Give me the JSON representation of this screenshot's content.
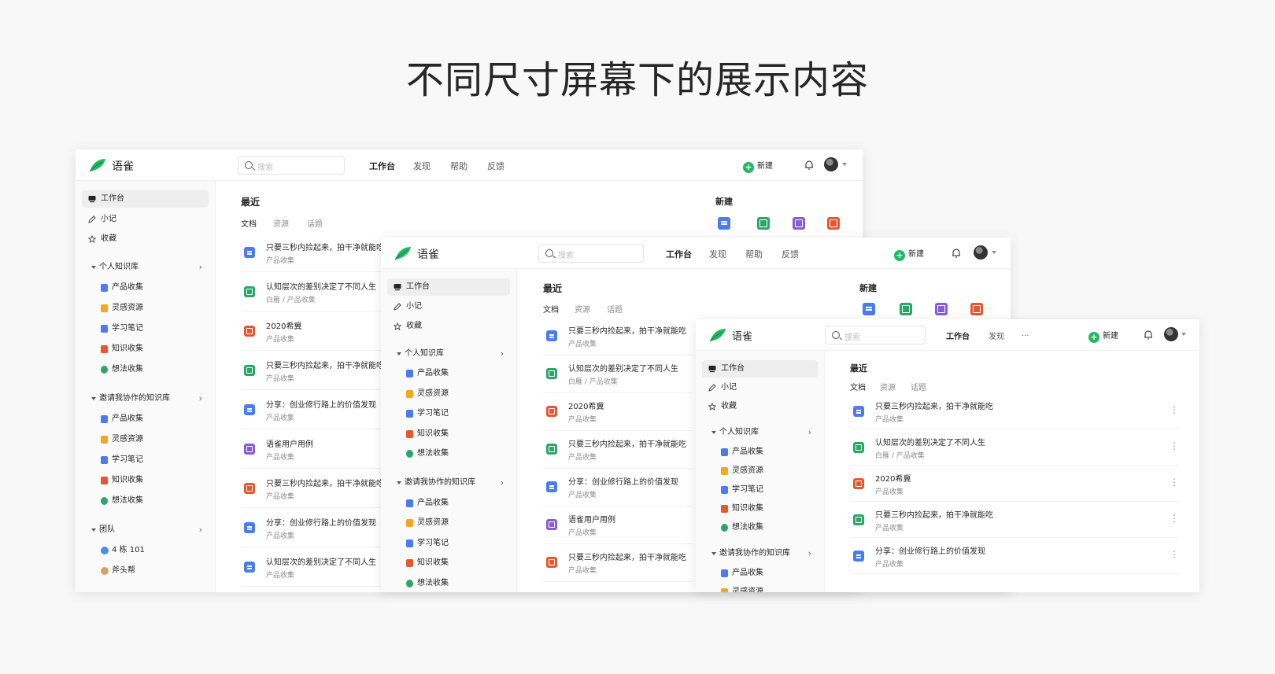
{
  "title": "不同尺寸屏幕下的展示内容",
  "brand": "语雀",
  "search_placeholder": "搜索",
  "nav": {
    "workbench": "工作台",
    "discover": "发现",
    "help": "帮助",
    "feedback": "反馈",
    "more": "..."
  },
  "new_label": "新建",
  "sidebar": {
    "workbench": "工作台",
    "notes": "小记",
    "favorites": "收藏",
    "personal_group": "个人知识库",
    "invited_group": "邀请我协作的知识库",
    "team_group": "团队",
    "books": [
      {
        "label": "产品收集",
        "icon": "book-blue-icon",
        "color": "#4a7cf0"
      },
      {
        "label": "灵感资源",
        "icon": "folder-orange-icon",
        "color": "#f5a623"
      },
      {
        "label": "学习笔记",
        "icon": "book-blue-icon",
        "color": "#4a7cf0"
      },
      {
        "label": "知识收集",
        "icon": "mind-red-icon",
        "color": "#e5582f"
      },
      {
        "label": "想法收集",
        "icon": "circle-green-icon",
        "color": "#2ca667"
      }
    ],
    "teams": [
      {
        "label": "4 栋 101",
        "color": "#4a90e2"
      },
      {
        "label": "斧头帮",
        "color": "#d9a066"
      }
    ]
  },
  "recent": {
    "heading": "最近",
    "tabs": [
      "文档",
      "资源",
      "话题"
    ],
    "items": [
      {
        "title": "只要三秒内捡起来，拍干净就能吃",
        "sub": "产品收集",
        "icon": "doc-blue"
      },
      {
        "title": "认知层次的差别决定了不同人生",
        "sub": "白雁 / 产品收集",
        "icon": "doc-green"
      },
      {
        "title": "2020希冀",
        "sub": "产品收集",
        "icon": "doc-red"
      },
      {
        "title": "只要三秒内捡起来，拍干净就能吃",
        "sub": "产品收集",
        "icon": "doc-green"
      },
      {
        "title": "分享：创业修行路上的价值发现",
        "sub": "产品收集",
        "icon": "doc-blue"
      },
      {
        "title": "语雀用户用例",
        "sub": "产品收集",
        "icon": "doc-purple"
      },
      {
        "title": "只要三秒内捡起来，拍干净就能吃",
        "sub": "产品收集",
        "icon": "doc-red"
      },
      {
        "title": "分享：创业修行路上的价值发现",
        "sub": "产品收集",
        "icon": "doc-blue"
      },
      {
        "title": "认知层次的差别决定了不同人生",
        "sub": "产品收集",
        "icon": "doc-blue"
      }
    ]
  },
  "new_section": {
    "heading": "新建",
    "icons": [
      "doc-blue",
      "sheet-green",
      "mindmap-purple",
      "board-red"
    ]
  }
}
